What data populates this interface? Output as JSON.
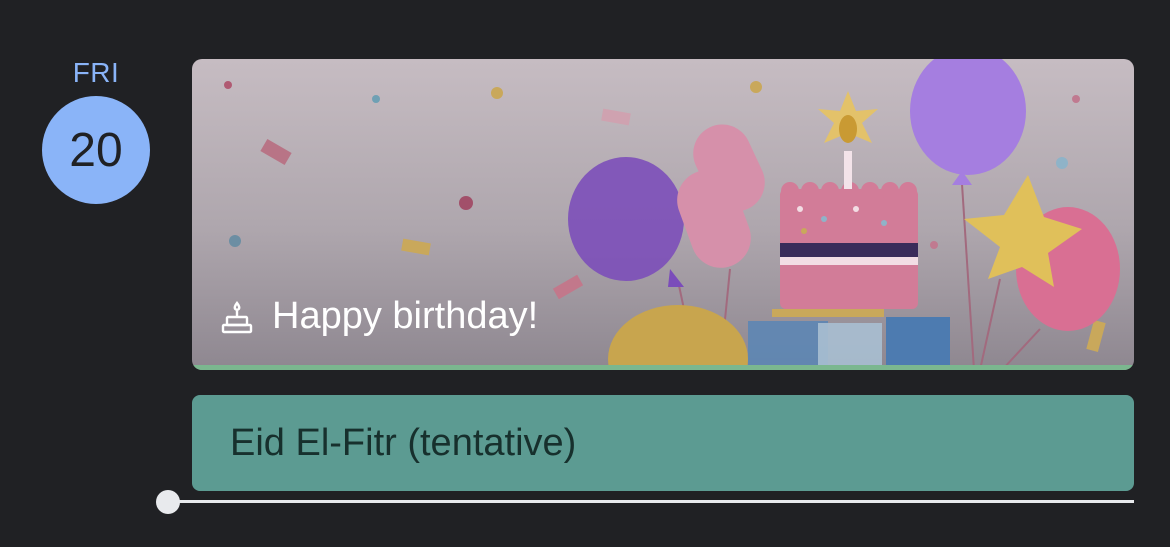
{
  "day": {
    "weekday": "FRI",
    "date": "20"
  },
  "events": {
    "birthday": {
      "title": "Happy birthday!",
      "icon": "birthday-cake-icon"
    },
    "eid": {
      "title": "Eid El-Fitr (tentative)",
      "color": "#5c9b92"
    }
  },
  "colors": {
    "accent": "#8ab4f8",
    "background": "#202124",
    "now_line": "#e8eaed"
  }
}
